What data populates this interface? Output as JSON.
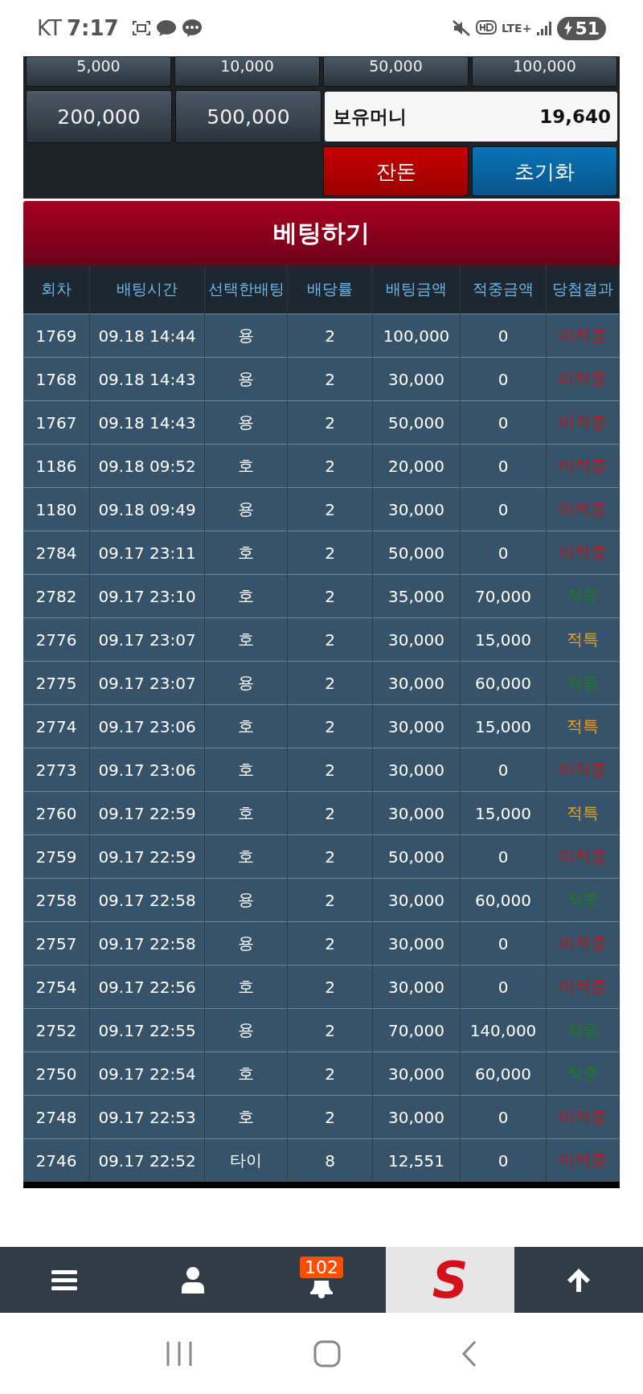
{
  "status_bar": {
    "carrier": "KT",
    "time": "7:17",
    "network": "LTE+",
    "battery": "51"
  },
  "amount_buttons_cut": [
    "5,000",
    "10,000",
    "50,000",
    "100,000"
  ],
  "amount_buttons": [
    "200,000",
    "500,000"
  ],
  "balance": {
    "label": "보유머니",
    "value": "19,640"
  },
  "action_buttons": [
    {
      "label": "잔돈",
      "kind": "change"
    },
    {
      "label": "초기화",
      "kind": "reset"
    }
  ],
  "bet_button": "베팅하기",
  "table": {
    "columns": [
      "회차",
      "배팅시간",
      "선택한배팅",
      "배당률",
      "배팅금액",
      "적중금액",
      "당첨결과"
    ],
    "rows": [
      {
        "round": "1769",
        "time": "09.18 14:44",
        "pick": "용",
        "odds": "2",
        "bet": "100,000",
        "payout": "0",
        "result": "미적중",
        "kind": "miss"
      },
      {
        "round": "1768",
        "time": "09.18 14:43",
        "pick": "용",
        "odds": "2",
        "bet": "30,000",
        "payout": "0",
        "result": "미적중",
        "kind": "miss"
      },
      {
        "round": "1767",
        "time": "09.18 14:43",
        "pick": "용",
        "odds": "2",
        "bet": "50,000",
        "payout": "0",
        "result": "미적중",
        "kind": "miss"
      },
      {
        "round": "1186",
        "time": "09.18 09:52",
        "pick": "호",
        "odds": "2",
        "bet": "20,000",
        "payout": "0",
        "result": "미적중",
        "kind": "miss"
      },
      {
        "round": "1180",
        "time": "09.18 09:49",
        "pick": "용",
        "odds": "2",
        "bet": "30,000",
        "payout": "0",
        "result": "미적중",
        "kind": "miss"
      },
      {
        "round": "2784",
        "time": "09.17 23:11",
        "pick": "호",
        "odds": "2",
        "bet": "50,000",
        "payout": "0",
        "result": "미적중",
        "kind": "miss"
      },
      {
        "round": "2782",
        "time": "09.17 23:10",
        "pick": "호",
        "odds": "2",
        "bet": "35,000",
        "payout": "70,000",
        "result": "적중",
        "kind": "win"
      },
      {
        "round": "2776",
        "time": "09.17 23:07",
        "pick": "호",
        "odds": "2",
        "bet": "30,000",
        "payout": "15,000",
        "result": "적특",
        "kind": "special"
      },
      {
        "round": "2775",
        "time": "09.17 23:07",
        "pick": "용",
        "odds": "2",
        "bet": "30,000",
        "payout": "60,000",
        "result": "적중",
        "kind": "win"
      },
      {
        "round": "2774",
        "time": "09.17 23:06",
        "pick": "호",
        "odds": "2",
        "bet": "30,000",
        "payout": "15,000",
        "result": "적특",
        "kind": "special"
      },
      {
        "round": "2773",
        "time": "09.17 23:06",
        "pick": "호",
        "odds": "2",
        "bet": "30,000",
        "payout": "0",
        "result": "미적중",
        "kind": "miss"
      },
      {
        "round": "2760",
        "time": "09.17 22:59",
        "pick": "호",
        "odds": "2",
        "bet": "30,000",
        "payout": "15,000",
        "result": "적특",
        "kind": "special"
      },
      {
        "round": "2759",
        "time": "09.17 22:59",
        "pick": "호",
        "odds": "2",
        "bet": "50,000",
        "payout": "0",
        "result": "미적중",
        "kind": "miss"
      },
      {
        "round": "2758",
        "time": "09.17 22:58",
        "pick": "용",
        "odds": "2",
        "bet": "30,000",
        "payout": "60,000",
        "result": "적중",
        "kind": "win"
      },
      {
        "round": "2757",
        "time": "09.17 22:58",
        "pick": "용",
        "odds": "2",
        "bet": "30,000",
        "payout": "0",
        "result": "미적중",
        "kind": "miss"
      },
      {
        "round": "2754",
        "time": "09.17 22:56",
        "pick": "호",
        "odds": "2",
        "bet": "30,000",
        "payout": "0",
        "result": "미적중",
        "kind": "miss"
      },
      {
        "round": "2752",
        "time": "09.17 22:55",
        "pick": "용",
        "odds": "2",
        "bet": "70,000",
        "payout": "140,000",
        "result": "적중",
        "kind": "win"
      },
      {
        "round": "2750",
        "time": "09.17 22:54",
        "pick": "호",
        "odds": "2",
        "bet": "30,000",
        "payout": "60,000",
        "result": "적중",
        "kind": "win"
      },
      {
        "round": "2748",
        "time": "09.17 22:53",
        "pick": "호",
        "odds": "2",
        "bet": "30,000",
        "payout": "0",
        "result": "미적중",
        "kind": "miss"
      },
      {
        "round": "2746",
        "time": "09.17 22:52",
        "pick": "타이",
        "odds": "8",
        "bet": "12,551",
        "payout": "0",
        "result": "미적중",
        "kind": "miss"
      }
    ]
  },
  "bottom_nav": {
    "notification_count": "102",
    "logo": "S"
  }
}
